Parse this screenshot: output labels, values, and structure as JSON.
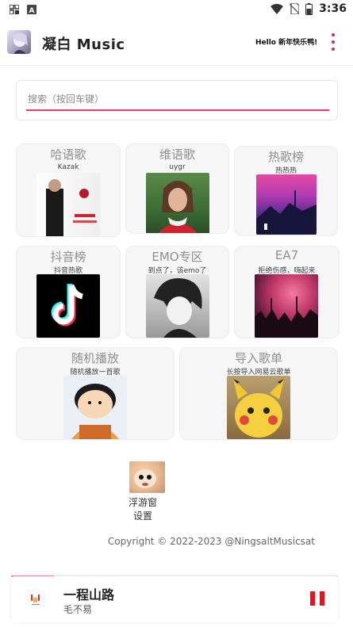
{
  "status_bar": {
    "time": "3:36",
    "left_icons": [
      "notification-grid-icon",
      "app-a-icon"
    ],
    "right_icons": [
      "wifi-icon",
      "no-sim-icon",
      "battery-icon"
    ]
  },
  "header": {
    "title": "凝白 Music",
    "greeting": "Hello 新年快乐鸭!",
    "menu_icon": "more-vertical-icon",
    "accent_color": "#e0245e"
  },
  "search": {
    "placeholder": "搜索（按回车键）",
    "value": ""
  },
  "cards": [
    {
      "title": "哈语歌",
      "subtitle": "Kazak"
    },
    {
      "title": "维语歌",
      "subtitle": "uygr"
    },
    {
      "title": "热歌榜",
      "subtitle": "热热热"
    },
    {
      "title": "抖音榜",
      "subtitle": "抖音热歌"
    },
    {
      "title": "EMO专区",
      "subtitle": "到点了，该emo了"
    },
    {
      "title": "EA7",
      "subtitle": "拒绝伤感，嗨起来"
    },
    {
      "title": "随机播放",
      "subtitle": "随机播放一首歌"
    },
    {
      "title": "导入歌单",
      "subtitle": "长按导入网易云歌单"
    }
  ],
  "floating_window": {
    "label_line1": "浮游窗",
    "label_line2": "设置"
  },
  "footer": {
    "copyright": "Copyright © 2022-2023 @NingsaltMusicsat"
  },
  "player": {
    "song_title": "一程山路",
    "artist": "毛不易",
    "progress_fraction": 0.13,
    "state": "playing",
    "pause_color": "#e8111c"
  }
}
